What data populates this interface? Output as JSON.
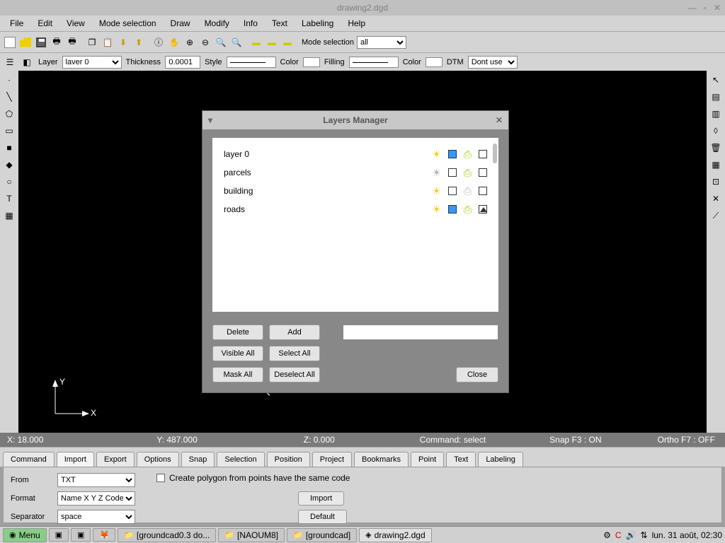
{
  "window": {
    "title": "drawing2.dgd"
  },
  "menu": [
    "File",
    "Edit",
    "View",
    "Mode selection",
    "Draw",
    "Modify",
    "Info",
    "Text",
    "Labeling",
    "Help"
  ],
  "toolbar1": {
    "mode_label": "Mode selection",
    "mode_value": "all"
  },
  "toolbar2": {
    "layer_label": "Layer",
    "layer_value": "laver 0",
    "thickness_label": "Thickness",
    "thickness_value": "0.0001",
    "style_label": "Style",
    "color_label": "Color",
    "filling_label": "Filling",
    "dtm_label": "DTM",
    "dtm_value": "Dont use"
  },
  "dialog": {
    "title": "Layers Manager",
    "layers": [
      {
        "name": "layer 0",
        "visible": true,
        "fill": "#3399ff",
        "printable": true,
        "lock": "empty"
      },
      {
        "name": "parcels",
        "visible": false,
        "fill": "",
        "printable": true,
        "lock": "empty"
      },
      {
        "name": "building",
        "visible": true,
        "fill": "",
        "printable": false,
        "lock": "empty"
      },
      {
        "name": "roads",
        "visible": true,
        "fill": "#3399ff",
        "printable": true,
        "lock": "tri"
      }
    ],
    "buttons": {
      "delete": "Delete",
      "add": "Add",
      "visible_all": "Visible All",
      "select_all": "Select All",
      "mask_all": "Mask All",
      "deselect_all": "Deselect All",
      "close": "Close"
    },
    "input_value": ""
  },
  "status": {
    "x": "X: 18.000",
    "y": "Y: 487.000",
    "z": "Z: 0.000",
    "cmd": "Command: select",
    "snap": "Snap F3 : ON",
    "ortho": "Ortho F7 : OFF"
  },
  "tabs": [
    "Command",
    "Import",
    "Export",
    "Options",
    "Snap",
    "Selection",
    "Position",
    "Project",
    "Bookmarks",
    "Point",
    "Text",
    "Labeling"
  ],
  "active_tab": 1,
  "import_panel": {
    "from_label": "From",
    "from_value": "TXT",
    "format_label": "Format",
    "format_value": "Name X Y Z Code",
    "sep_label": "Separator",
    "sep_value": "space",
    "checkbox_label": "Create polygon from points have the same code",
    "import_btn": "Import",
    "default_btn": "Default"
  },
  "taskbar": {
    "menu": "Menu",
    "items": [
      {
        "label": "[groundcad0.3 do..."
      },
      {
        "label": "[NAOUM8]"
      },
      {
        "label": "[groundcad]"
      },
      {
        "label": "drawing2.dgd",
        "active": true
      }
    ],
    "clock": "lun. 31 août, 02:30"
  },
  "axis": {
    "y": "Y",
    "x": "X"
  }
}
